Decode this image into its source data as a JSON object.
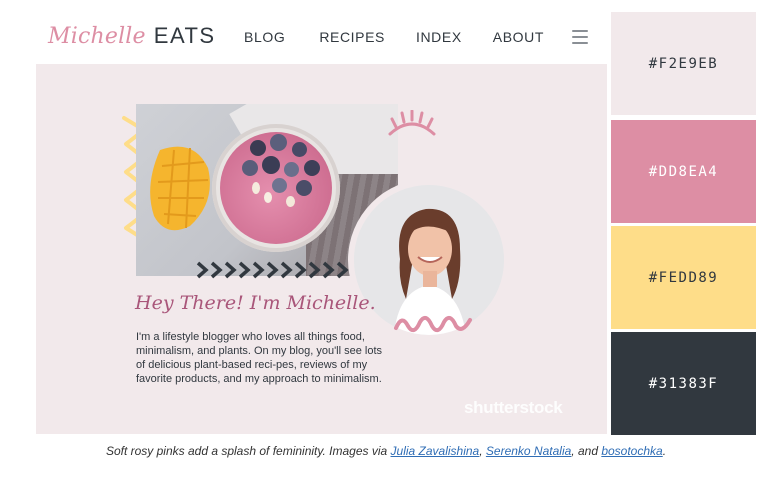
{
  "site": {
    "logo_script": "Michelle",
    "logo_bold": "EATS",
    "nav": [
      "BLOG",
      "RECIPES",
      "INDEX",
      "ABOUT"
    ],
    "heading": "Hey There! I'm Michelle.",
    "intro": "I'm a lifestyle blogger who loves all things food, minimalism, and plants. On my blog, you'll see lots of delicious plant-based reci-pes, reviews of my favorite products, and my approach to minimalism.",
    "watermark": "shutterstock"
  },
  "palette": [
    {
      "hex": "#F2E9EB",
      "text_color": "#31383F"
    },
    {
      "hex": "#DD8EA4",
      "text_color": "#ffffff"
    },
    {
      "hex": "#FEDD89",
      "text_color": "#31383F"
    },
    {
      "hex": "#31383F",
      "text_color": "#ffffff"
    }
  ],
  "caption": {
    "prefix": "Soft rosy pinks add a splash of femininity. Images via ",
    "link1": "Julia Zavalishina",
    "sep1": ", ",
    "link2": "Serenko Natalia",
    "sep2": ", and ",
    "link3": "bosotochka",
    "suffix": "."
  },
  "icons": [
    "hamburger-menu-icon"
  ]
}
